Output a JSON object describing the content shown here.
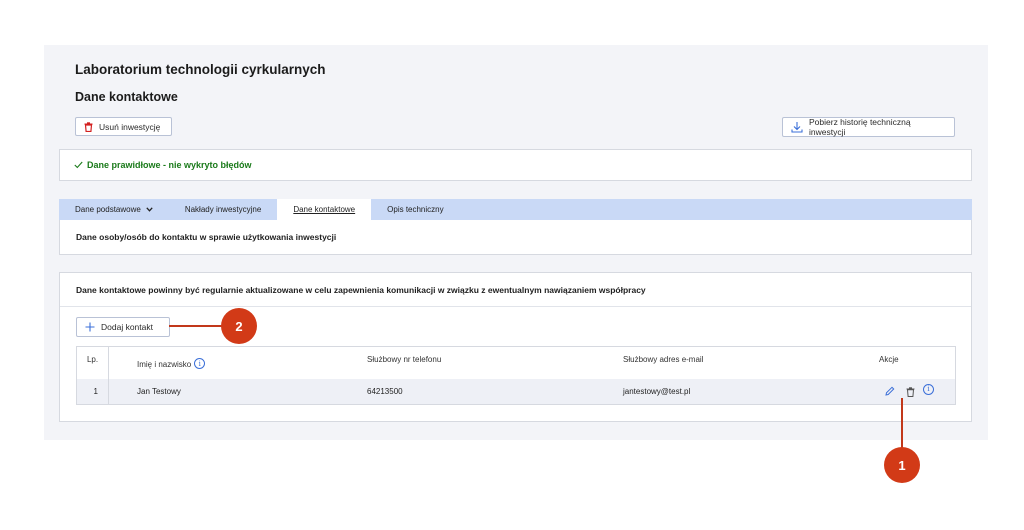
{
  "header": {
    "org_title": "Laboratorium technologii cyrkularnych",
    "section_title": "Dane kontaktowe"
  },
  "toolbar": {
    "delete_label": "Usuń inwestycję",
    "history_label": "Pobierz historię techniczną inwestycji"
  },
  "validation": {
    "message": "Dane prawidłowe - nie wykryto błędów"
  },
  "tabs": [
    {
      "label": "Dane podstawowe",
      "has_dropdown": true
    },
    {
      "label": "Nakłady inwestycyjne"
    },
    {
      "label": "Dane kontaktowe",
      "active": true
    },
    {
      "label": "Opis techniczny"
    }
  ],
  "tab_content": {
    "subtitle": "Dane osoby/osób do kontaktu w sprawie użytkowania inwestycji"
  },
  "contacts": {
    "note": "Dane kontaktowe powinny być regularnie aktualizowane w celu zapewnienia komunikacji w związku z ewentualnym nawiązaniem współpracy",
    "add_label": "Dodaj kontakt",
    "columns": {
      "lp": "Lp.",
      "name": "Imię i nazwisko",
      "phone": "Służbowy nr telefonu",
      "email": "Służbowy adres e-mail",
      "actions": "Akcje"
    },
    "rows": [
      {
        "lp": "1",
        "name": "Jan Testowy",
        "phone": "64213500",
        "email": "jantestowy@test.pl"
      }
    ]
  },
  "annotations": {
    "marker_1": "1",
    "marker_2": "2"
  },
  "colors": {
    "success": "#1a7a1a",
    "tab_bar": "#c9d9f6",
    "danger": "#d32020",
    "accent": "#3b6fd8",
    "marker": "#d23a17"
  }
}
